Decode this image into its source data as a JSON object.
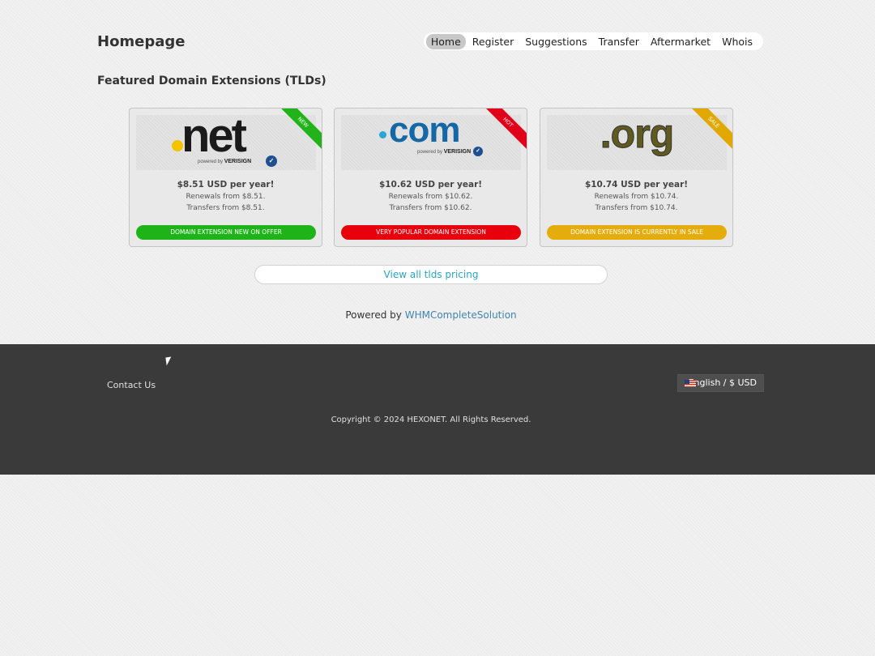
{
  "header": {
    "title": "Homepage",
    "nav": [
      "Home",
      "Register",
      "Suggestions",
      "Transfer",
      "Aftermarket",
      "Whois"
    ]
  },
  "featured": {
    "title": "Featured Domain Extensions (TLDs)",
    "cards": [
      {
        "tld": ".net",
        "logo_text": "net",
        "powered": "powered by",
        "brand": "VERISIGN",
        "ribbon": "NEW",
        "ribbon_color": "#22b21a",
        "price": "$8.51 USD per year!",
        "renewals": "Renewals from $8.51.",
        "transfers": "Transfers from $8.51.",
        "badge": "DOMAIN EXTENSION NEW ON OFFER",
        "badge_color": "#1fb31a"
      },
      {
        "tld": ".com",
        "logo_text": "com",
        "powered": "powered by",
        "brand": "VERISIGN",
        "ribbon": "HOT",
        "ribbon_color": "#e0001a",
        "price": "$10.62 USD per year!",
        "renewals": "Renewals from $10.62.",
        "transfers": "Transfers from $10.62.",
        "badge": "VERY POPULAR DOMAIN EXTENSION",
        "badge_color": "#e8000c"
      },
      {
        "tld": ".org",
        "logo_text": ".org",
        "ribbon": "SALE",
        "ribbon_color": "#e0a800",
        "price": "$10.74 USD per year!",
        "renewals": "Renewals from $10.74.",
        "transfers": "Transfers from $10.74.",
        "badge": "DOMAIN EXTENSION IS CURRENTLY IN SALE",
        "badge_color": "#e4ad0c"
      }
    ]
  },
  "view_all_label": "View all tlds pricing",
  "powered_by": {
    "prefix": "Powered by",
    "link": "WHMCompleteSolution"
  },
  "footer": {
    "contact": "Contact Us",
    "language": "English / $ USD",
    "copyright": "Copyright © 2024 HEXONET. All Rights Reserved."
  }
}
